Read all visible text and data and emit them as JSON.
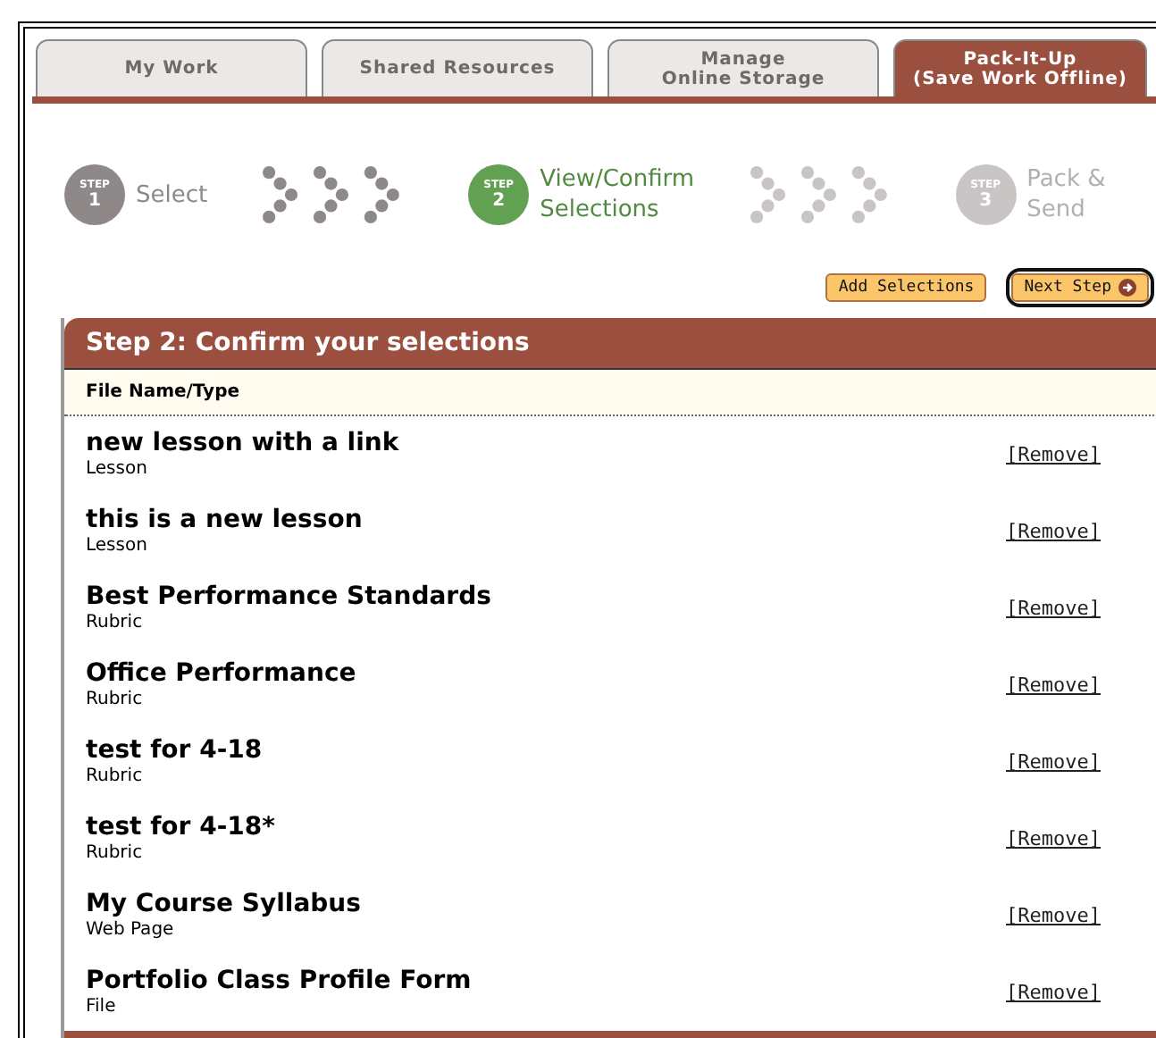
{
  "tabs": [
    {
      "label": "My Work",
      "selected": false
    },
    {
      "label": "Shared Resources",
      "selected": false
    },
    {
      "label": "Manage\nOnline Storage",
      "selected": false
    },
    {
      "label": "Pack-It-Up\n(Save Work Offline)",
      "selected": true
    }
  ],
  "steps": [
    {
      "badge": "STEP",
      "number": "1",
      "label": "Select",
      "current": false,
      "reached": true
    },
    {
      "badge": "STEP",
      "number": "2",
      "label": "View/Confirm\nSelections",
      "current": true,
      "reached": true
    },
    {
      "badge": "STEP",
      "number": "3",
      "label": "Pack &\nSend",
      "current": false,
      "reached": false
    }
  ],
  "buttons": [
    {
      "label": "Add Selections",
      "focused": false,
      "arrow": false
    },
    {
      "label": "Next Step",
      "focused": true,
      "arrow": true
    }
  ],
  "panel": {
    "title": "Step 2: Confirm your selections",
    "column": "File Name/Type",
    "rows": [
      {
        "name": "new lesson with a link",
        "type": "Lesson",
        "action": "[Remove]"
      },
      {
        "name": "this is a new lesson",
        "type": "Lesson",
        "action": "[Remove]"
      },
      {
        "name": "Best Performance Standards",
        "type": "Rubric",
        "action": "[Remove]"
      },
      {
        "name": "Office Performance",
        "type": "Rubric",
        "action": "[Remove]"
      },
      {
        "name": "test for 4-18",
        "type": "Rubric",
        "action": "[Remove]"
      },
      {
        "name": "test for 4-18*",
        "type": "Rubric",
        "action": "[Remove]"
      },
      {
        "name": "My Course Syllabus",
        "type": "Web Page",
        "action": "[Remove]"
      },
      {
        "name": "Portfolio Class Profile Form",
        "type": "File",
        "action": "[Remove]"
      }
    ]
  }
}
